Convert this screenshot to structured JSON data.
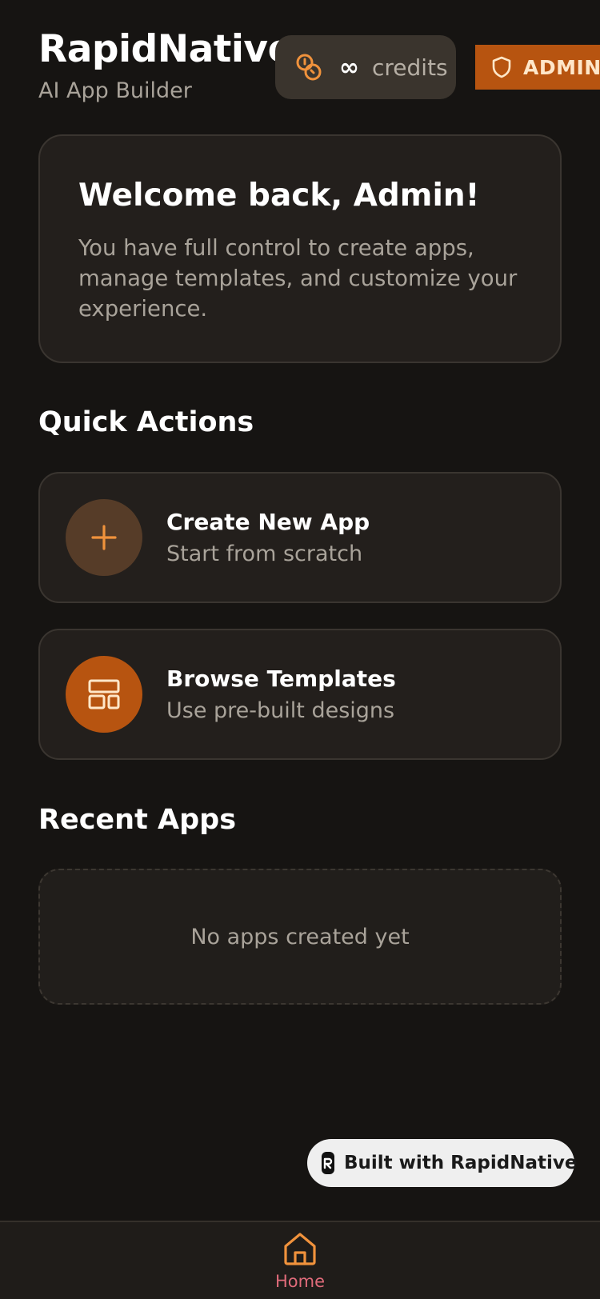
{
  "header": {
    "title": "RapidNative",
    "subtitle": "AI App Builder",
    "credits_value": "∞",
    "credits_label": "credits",
    "admin_label": "ADMIN"
  },
  "welcome": {
    "title": "Welcome back, Admin!",
    "text": "You have full control to create apps, manage templates, and customize your experience."
  },
  "quick_actions": {
    "title": "Quick Actions",
    "items": [
      {
        "title": "Create New App",
        "subtitle": "Start from scratch",
        "icon": "plus-icon"
      },
      {
        "title": "Browse Templates",
        "subtitle": "Use pre-built designs",
        "icon": "layout-template-icon"
      }
    ]
  },
  "recent_apps": {
    "title": "Recent Apps",
    "empty_text": "No apps created yet"
  },
  "built_with": {
    "label": "Built with RapidNative"
  },
  "nav": {
    "items": [
      {
        "label": "Home",
        "icon": "home-icon"
      }
    ]
  },
  "colors": {
    "background": "#161412",
    "card": "#231f1c",
    "accent": "#b75410",
    "accent_light": "#f0923c",
    "muted_text": "#a9a39a",
    "nav_active": "#e06b7a"
  }
}
